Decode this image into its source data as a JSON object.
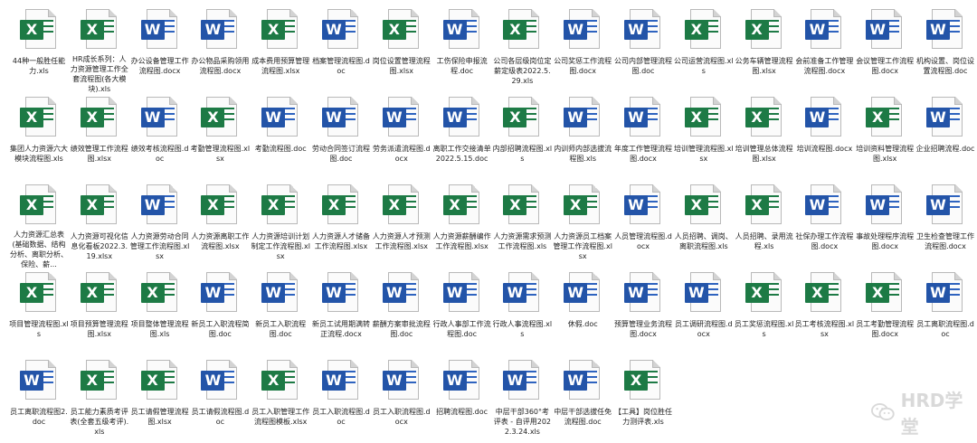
{
  "files": [
    {
      "name": "44种一般胜任能力.xls",
      "type": "xls"
    },
    {
      "name": "HR成长系列：人力资源管理工作全套流程图(各大模块).xls",
      "type": "xls"
    },
    {
      "name": "办公设备管理工作流程图.docx",
      "type": "doc"
    },
    {
      "name": "办公物品采购领用流程图.docx",
      "type": "doc"
    },
    {
      "name": "成本费用预算管理流程图.xlsx",
      "type": "xls"
    },
    {
      "name": "档案管理流程图.doc",
      "type": "doc"
    },
    {
      "name": "岗位设置管理流程图.xlsx",
      "type": "xls"
    },
    {
      "name": "工伤保险申报流程.doc",
      "type": "doc"
    },
    {
      "name": "公司各层级岗位定薪定级表2022.5.29.xls",
      "type": "xls"
    },
    {
      "name": "公司奖惩工作流程图.docx",
      "type": "doc"
    },
    {
      "name": "公司内部管理流程图.doc",
      "type": "doc"
    },
    {
      "name": "公司运营流程图.xls",
      "type": "xls"
    },
    {
      "name": "公务车辆管理流程图.xlsx",
      "type": "xls"
    },
    {
      "name": "会前准备工作管理流程图.docx",
      "type": "doc"
    },
    {
      "name": "会议管理工作流程图.docx",
      "type": "doc"
    },
    {
      "name": "机构设置、岗位设置流程图.doc",
      "type": "doc"
    },
    {
      "name": "集团人力资源六大模块流程图.xls",
      "type": "xls"
    },
    {
      "name": "绩效管理工作流程图.xlsx",
      "type": "xls"
    },
    {
      "name": "绩效考核流程图.doc",
      "type": "doc"
    },
    {
      "name": "考勤管理流程图.xlsx",
      "type": "xls"
    },
    {
      "name": "考勤流程图.doc",
      "type": "doc"
    },
    {
      "name": "劳动合同签订流程图.doc",
      "type": "doc"
    },
    {
      "name": "劳务派遣流程图.docx",
      "type": "doc"
    },
    {
      "name": "离职工作交接清单2022.5.15.doc",
      "type": "doc"
    },
    {
      "name": "内部招聘流程图.xls",
      "type": "xls"
    },
    {
      "name": "内训师内部选拔流程图.xls",
      "type": "doc"
    },
    {
      "name": "年度工作管理流程图.docx",
      "type": "doc"
    },
    {
      "name": "培训管理流程图.xlsx",
      "type": "xls"
    },
    {
      "name": "培训管理总体流程图.xlsx",
      "type": "xls"
    },
    {
      "name": "培训流程图.docx",
      "type": "doc"
    },
    {
      "name": "培训资料管理流程图.xlsx",
      "type": "xls"
    },
    {
      "name": "企业招聘流程.doc",
      "type": "doc"
    },
    {
      "name": "人力资源汇总表(基础数据、结构分析、离职分析、保险、薪...",
      "type": "xls"
    },
    {
      "name": "人力资源可视化信息化看板2022.3.19.xlsx",
      "type": "xls"
    },
    {
      "name": "人力资源劳动合同管理工作流程图.xlsx",
      "type": "doc"
    },
    {
      "name": "人力资源离职工作流程图.xlsx",
      "type": "xls"
    },
    {
      "name": "人力资源培训计划制定工作流程图.xlsx",
      "type": "xls"
    },
    {
      "name": "人力资源人才储备工作流程图.xlsx",
      "type": "xls"
    },
    {
      "name": "人力资源人才预测工作流程图.xlsx",
      "type": "xls"
    },
    {
      "name": "人力资源薪酬编作工作流程图.xlsx",
      "type": "xls"
    },
    {
      "name": "人力资源需求预测工作流程图.xls",
      "type": "xls"
    },
    {
      "name": "人力资源员工档案管理工作流程图.xlsx",
      "type": "xls"
    },
    {
      "name": "人员管理流程图.docx",
      "type": "doc"
    },
    {
      "name": "人员招聘、调岗、离职流程图.xls",
      "type": "xls"
    },
    {
      "name": "人员招聘、录用流程.xls",
      "type": "xls"
    },
    {
      "name": "社保办理工作流程图.docx",
      "type": "doc"
    },
    {
      "name": "事故处理程序流程图.docx",
      "type": "doc"
    },
    {
      "name": "卫生检查管理工作流程图.docx",
      "type": "doc"
    },
    {
      "name": "项目管理流程图.xls",
      "type": "xls"
    },
    {
      "name": "项目预算管理流程图.xlsx",
      "type": "xls"
    },
    {
      "name": "项目整体管理流程图.xls",
      "type": "xls"
    },
    {
      "name": "新员工入职流程简图.doc",
      "type": "doc"
    },
    {
      "name": "新员工入职流程图.doc",
      "type": "doc"
    },
    {
      "name": "新员工试用期满转正流程.docx",
      "type": "doc"
    },
    {
      "name": "薪酬方案审批流程图.doc",
      "type": "doc"
    },
    {
      "name": "行政人事部工作流程图.doc",
      "type": "doc"
    },
    {
      "name": "行政人事流程图.xls",
      "type": "doc"
    },
    {
      "name": "休假.doc",
      "type": "doc"
    },
    {
      "name": "预算管理业务流程图.docx",
      "type": "doc"
    },
    {
      "name": "员工调研流程图.docx",
      "type": "doc"
    },
    {
      "name": "员工奖惩流程图.xls",
      "type": "xls"
    },
    {
      "name": "员工考核流程图.xlsx",
      "type": "xls"
    },
    {
      "name": "员工考勤管理流程图.docx",
      "type": "xls"
    },
    {
      "name": "员工离职流程图.doc",
      "type": "doc"
    },
    {
      "name": "员工离职流程图2.doc",
      "type": "doc"
    },
    {
      "name": "员工能力素质考评表(全套五级考评).xls",
      "type": "xls"
    },
    {
      "name": "员工请假管理流程图.xlsx",
      "type": "xls"
    },
    {
      "name": "员工请假流程图.doc",
      "type": "doc"
    },
    {
      "name": "员工入职管理工作流程图模板.xlsx",
      "type": "xls"
    },
    {
      "name": "员工入职流程图.doc",
      "type": "doc"
    },
    {
      "name": "员工入职流程图.docx",
      "type": "doc"
    },
    {
      "name": "招聘流程图.doc",
      "type": "doc"
    },
    {
      "name": "中层干部360°考评表 - 自评用2022.3.24.xls",
      "type": "doc"
    },
    {
      "name": "中层干部选拔任免流程图.doc",
      "type": "doc"
    },
    {
      "name": "【工具】岗位胜任力测评表.xls",
      "type": "xls"
    }
  ],
  "watermark": {
    "text": "HRD学堂",
    "icon": "wechat-icon"
  }
}
